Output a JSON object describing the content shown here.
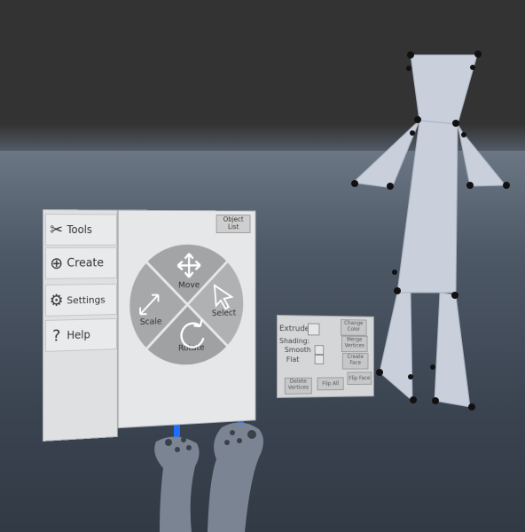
{
  "sidebar": {
    "items": [
      {
        "label": "Tools",
        "icon": "tools-icon"
      },
      {
        "label": "Create",
        "icon": "plus-circle-icon"
      },
      {
        "label": "Settings",
        "icon": "gear-icon"
      },
      {
        "label": "Help",
        "icon": "question-icon"
      }
    ]
  },
  "main": {
    "object_list_line1": "Object",
    "object_list_line2": "List",
    "radial": {
      "move": "Move",
      "select": "Select",
      "rotate": "Rotate",
      "scale": "Scale"
    }
  },
  "modeling": {
    "extrude": "Extrude",
    "shading": "Shading:",
    "smooth": "Smooth",
    "flat": "Flat",
    "change_color_1": "Change",
    "change_color_2": "Color",
    "merge_vertices_1": "Merge",
    "merge_vertices_2": "Vertices",
    "create_face_1": "Create",
    "create_face_2": "Face",
    "delete_vertices_1": "Delete",
    "delete_vertices_2": "Vertices",
    "flip_all": "Flip All",
    "flip_face": "Flip Face"
  },
  "colors": {
    "ray": "#1e6fff",
    "panel": "#e6e7e9",
    "figure": "#c9d0dc"
  }
}
